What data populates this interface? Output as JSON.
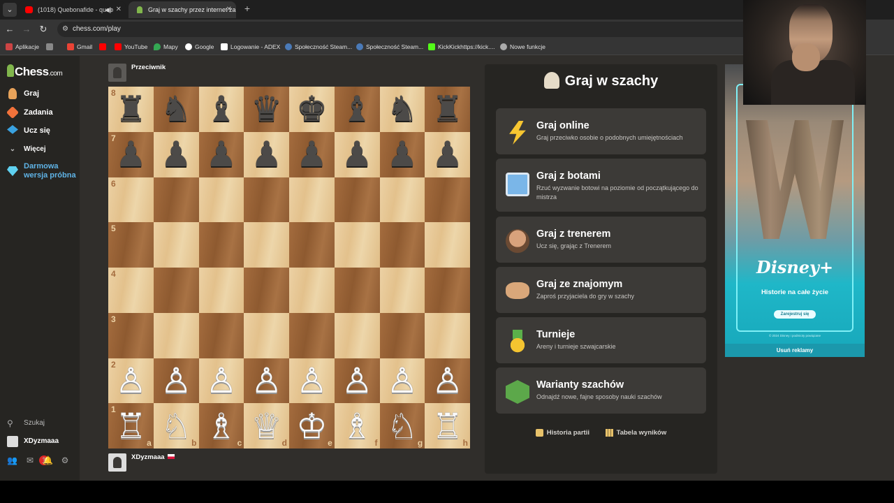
{
  "browser": {
    "tabs": [
      {
        "title": "(1018) Quebonafide - queb",
        "favicon_color": "#ff0000",
        "audio": true
      },
      {
        "title": "Graj w szachy przez internet za",
        "favicon_color": "#81b64c",
        "audio": false
      }
    ],
    "new_tab_symbol": "+",
    "url": "chess.com/play",
    "bookmarks": [
      {
        "label": "Aplikacje",
        "color": "#cc4444"
      },
      {
        "label": "",
        "color": "#888888"
      },
      {
        "label": "Gmail",
        "color": "#ea4335"
      },
      {
        "label": "",
        "color": "#ff0000"
      },
      {
        "label": "YouTube",
        "color": "#ff0000"
      },
      {
        "label": "Mapy",
        "color": "#34a853"
      },
      {
        "label": "Google",
        "color": "#ffffff"
      },
      {
        "label": "Logowanie - ADEX",
        "color": "#ffffff"
      },
      {
        "label": "Społeczność Steam...",
        "color": "#4a7ab8"
      },
      {
        "label": "Społeczność Steam...",
        "color": "#4a7ab8"
      },
      {
        "label": "KickKickhttps://kick....",
        "color": "#53fc18"
      },
      {
        "label": "Nowe funkcje",
        "color": "#aaaaaa"
      }
    ]
  },
  "sidebar": {
    "logo": "Chess",
    "logo_suffix": ".com",
    "items": [
      {
        "label": "Graj",
        "icon": "pawn-hand-icon",
        "color": "#e8a35a"
      },
      {
        "label": "Zadania",
        "icon": "puzzle-icon",
        "color": "#f2723a"
      },
      {
        "label": "Ucz się",
        "icon": "graduation-cap-icon",
        "color": "#3aa2e0"
      },
      {
        "label": "Więcej",
        "icon": "chevron-down-icon",
        "color": "#bbbbbb"
      }
    ],
    "trial": "Darmowa wersja próbna",
    "search": "Szukaj",
    "username": "XDyzmaaa",
    "notification_count": "1"
  },
  "game": {
    "opponent": "Przeciwnik",
    "player": "XDyzmaaa",
    "ranks": [
      "8",
      "7",
      "6",
      "5",
      "4",
      "3",
      "2",
      "1"
    ],
    "files": [
      "a",
      "b",
      "c",
      "d",
      "e",
      "f",
      "g",
      "h"
    ],
    "position": [
      [
        "♜",
        "♞",
        "♝",
        "♛",
        "♚",
        "♝",
        "♞",
        "♜"
      ],
      [
        "♟",
        "♟",
        "♟",
        "♟",
        "♟",
        "♟",
        "♟",
        "♟"
      ],
      [
        "",
        "",
        "",
        "",
        "",
        "",
        "",
        ""
      ],
      [
        "",
        "",
        "",
        "",
        "",
        "",
        "",
        ""
      ],
      [
        "",
        "",
        "",
        "",
        "",
        "",
        "",
        ""
      ],
      [
        "",
        "",
        "",
        "",
        "",
        "",
        "",
        ""
      ],
      [
        "♙",
        "♙",
        "♙",
        "♙",
        "♙",
        "♙",
        "♙",
        "♙"
      ],
      [
        "♖",
        "♘",
        "♗",
        "♕",
        "♔",
        "♗",
        "♘",
        "♖"
      ]
    ]
  },
  "panel": {
    "title": "Graj w szachy",
    "options": [
      {
        "title": "Graj online",
        "subtitle": "Graj przeciwko osobie o podobnych umiejętnościach",
        "icon": "lightning-icon"
      },
      {
        "title": "Graj z botami",
        "subtitle": "Rzuć wyzwanie botowi na poziomie od początkującego do mistrza",
        "icon": "robot-icon"
      },
      {
        "title": "Graj z trenerem",
        "subtitle": "Ucz się, grając z Trenerem",
        "icon": "coach-icon"
      },
      {
        "title": "Graj ze znajomym",
        "subtitle": "Zaproś przyjaciela do gry w szachy",
        "icon": "handshake-icon"
      },
      {
        "title": "Turnieje",
        "subtitle": "Areny i turnieje szwajcarskie",
        "icon": "medal-icon"
      },
      {
        "title": "Warianty szachów",
        "subtitle": "Odnajdź nowe, fajne sposoby nauki szachów",
        "icon": "variants-cube-icon"
      }
    ],
    "links": [
      {
        "label": "Historia partii",
        "icon": "history-icon"
      },
      {
        "label": "Tabela wyników",
        "icon": "leaderboard-icon"
      }
    ]
  },
  "ad": {
    "logo": "Disney+",
    "tagline": "Historie na całe życie",
    "button": "Zarejestruj się",
    "fine_print": "© 2024 Disney i podmioty powiązane",
    "remove": "Usuń reklamy"
  }
}
